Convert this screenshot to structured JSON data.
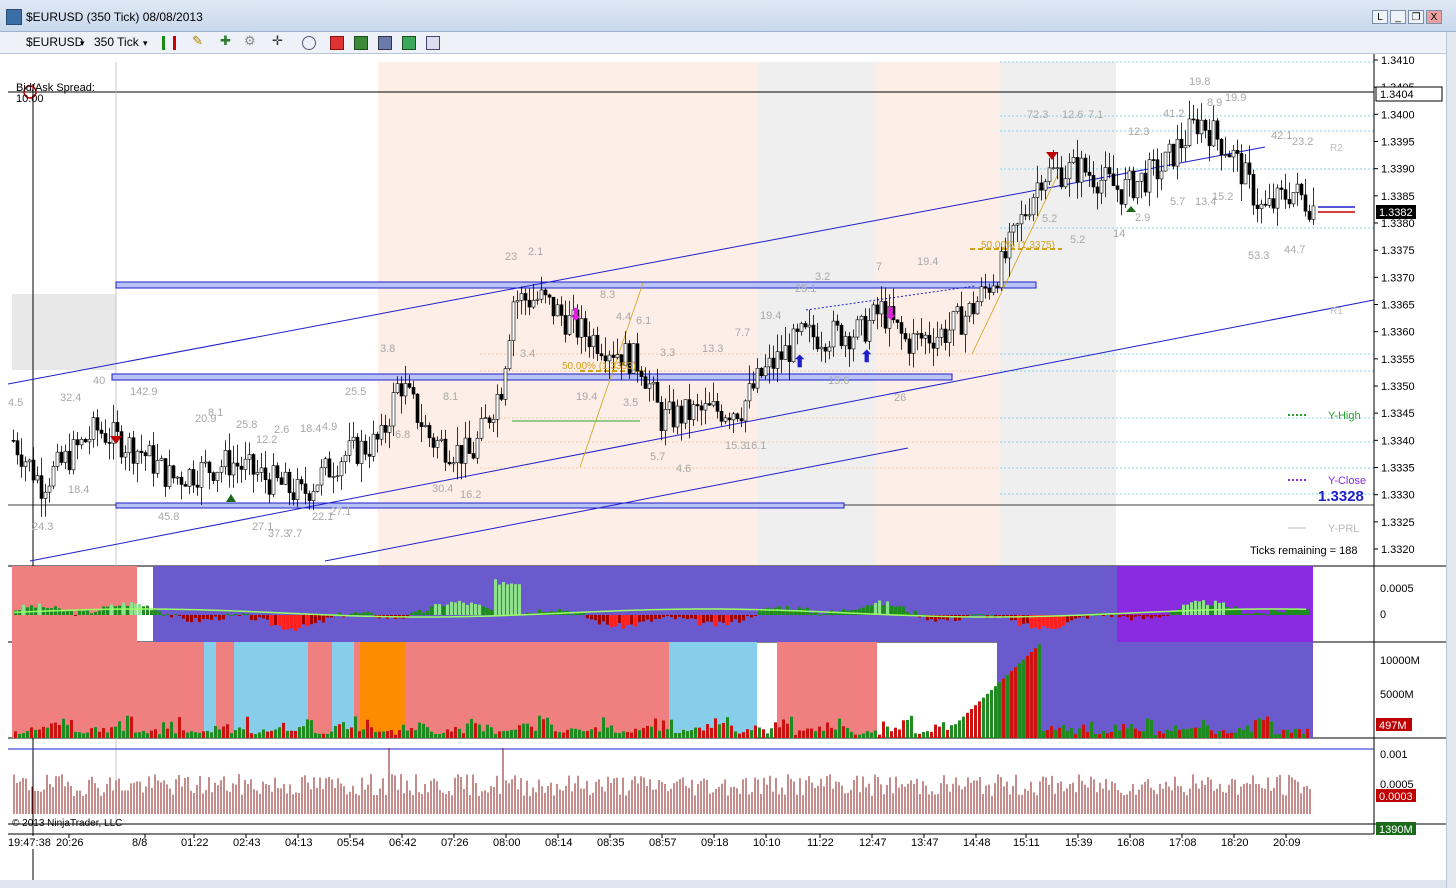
{
  "window": {
    "title": "$EURUSD (350 Tick)  08/08/2013",
    "btn_restore": "L",
    "btn_minimize": "_",
    "btn_maximize": "❐",
    "btn_close": "X"
  },
  "toolbar": {
    "instrument": "$EURUSD",
    "period": "350 Tick",
    "icons": [
      "bar-style-icon",
      "draw-pencil-icon",
      "indicators-icon",
      "strategies-icon",
      "crosshair-icon",
      "zoom-icon",
      "data-box-icon",
      "chart-trader-icon",
      "properties-icon",
      "template-icon"
    ]
  },
  "chart": {
    "bid_ask_label": "Bid/Ask Spread:",
    "bid_ask_value": "10.00",
    "copyright": "© 2013 NinjaTrader, LLC",
    "cursor_time": "19:47:38",
    "ticks_remaining": "Ticks remaining = 188",
    "y_labels": [
      "1.3410",
      "1.3405",
      "1.3400",
      "1.3395",
      "1.3390",
      "1.3385",
      "1.3380",
      "1.3375",
      "1.3370",
      "1.3365",
      "1.3360",
      "1.3355",
      "1.3350",
      "1.3345",
      "1.3340",
      "1.3335",
      "1.3330",
      "1.3325",
      "1.3320"
    ],
    "price_marker_top": "1.3404",
    "price_marker_last": "1.3382",
    "y_high_label": "Y-High",
    "y_close_label": "Y-Close",
    "y_close_value": "1.3328",
    "y_prl_label": "Y-PRL",
    "r2_label": "R2",
    "r1_label": "R1",
    "fib_label_1": "50.00% (1.3375)",
    "fib_label_2": "50.00% (1.3353)",
    "x_labels": [
      "20:26",
      "8/8",
      "01:22",
      "02:43",
      "04:13",
      "05:54",
      "06:42",
      "07:26",
      "08:00",
      "08:14",
      "08:35",
      "08:57",
      "09:18",
      "10:10",
      "11:22",
      "12:47",
      "13:47",
      "14:48",
      "15:11",
      "15:39",
      "16:08",
      "17:08",
      "18:20",
      "20:09"
    ],
    "annotations": [
      "4.5",
      "32.4",
      "40",
      "142.9",
      "20.9",
      "8.1",
      "25.8",
      "12.2",
      "2.6",
      "18.4",
      "4.9",
      "25.5",
      "3.8",
      "23",
      "2.1",
      "8.3",
      "6.1",
      "4.4",
      "3.4",
      "3.3",
      "13.3",
      "7.7",
      "19.4",
      "3.2",
      "25.1",
      "7",
      "19.4",
      "72.3",
      "12.6",
      "7.1",
      "12.3",
      "41.2",
      "19.8",
      "8.9",
      "19.9",
      "42.1",
      "23.2",
      "5.7",
      "13.4",
      "15.2",
      "5.2",
      "5.2",
      "14",
      "2.9",
      "53.3",
      "44.7",
      "18.4",
      "24.3",
      "45.8",
      "27.1",
      "37.3",
      "7.7",
      "22.1",
      "27.1",
      "6.8",
      "8.1",
      "30.4",
      "16.2",
      "19.4",
      "3.5",
      "5.7",
      "4.6",
      "15.3",
      "16.1",
      "15.6",
      "26"
    ],
    "osc_labels": [
      "0.0005",
      "0"
    ],
    "vol_labels": [
      "10000M",
      "5000M"
    ],
    "vol_marker": "497M",
    "bottom_labels": [
      "0.001",
      "0.0005"
    ],
    "bottom_marker": "0.0003",
    "bottom_vol_marker": "1390M"
  },
  "colors": {
    "channel": "#1e1ecc",
    "zone_fill": "#b9c4f5",
    "up_candle": "#1f8a1f",
    "down_candle": "#cc1111",
    "session_pink": "#fdeee8",
    "session_gray": "#efefef",
    "osc_purple": "#6a5acd",
    "osc_pink": "#f08080",
    "skyblue": "#87ceeb",
    "orange": "#ff8c00",
    "violet": "#8a2be2",
    "marker_green": "#2aa02a",
    "marker_red": "#c00000"
  }
}
